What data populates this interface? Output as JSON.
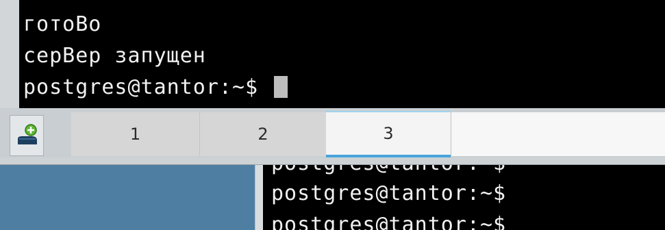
{
  "foreground_terminal": {
    "lines": [
      "готоВо",
      "серВер запущен",
      "postgres@tantor:~$"
    ]
  },
  "tabs": [
    {
      "label": "1",
      "active": false
    },
    {
      "label": "2",
      "active": false
    },
    {
      "label": "3",
      "active": true
    }
  ],
  "new_tab_icon": "new-terminal-icon",
  "background_terminal": {
    "lines": [
      "postgres@tantor:~$",
      "postgres@tantor:~$",
      "postgres@tantor:~$"
    ]
  },
  "colors": {
    "terminal_bg": "#000000",
    "terminal_fg": "#f2f2f2",
    "active_tab_accent": "#4aa4dc",
    "desktop": "#4f7ea3"
  }
}
